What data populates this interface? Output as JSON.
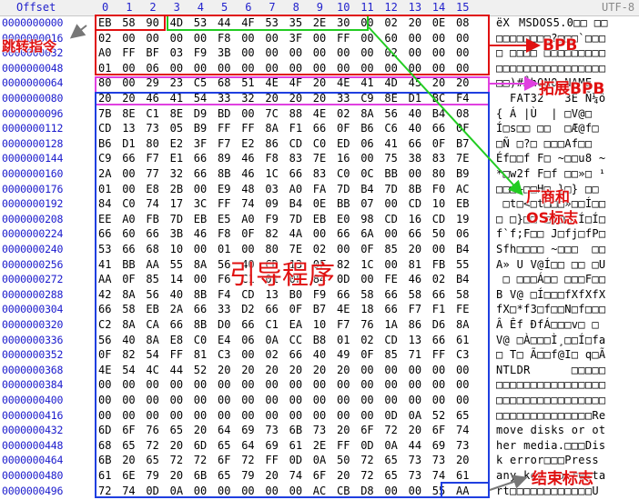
{
  "header": {
    "offset_label": "Offset",
    "columns": [
      "0",
      "1",
      "2",
      "3",
      "4",
      "5",
      "6",
      "7",
      "8",
      "9",
      "10",
      "11",
      "12",
      "13",
      "14",
      "15"
    ],
    "encoding_label": "UTF-8"
  },
  "rows": [
    {
      "offset": "0000000000",
      "hex": [
        "EB",
        "58",
        "90",
        "4D",
        "53",
        "44",
        "4F",
        "53",
        "35",
        "2E",
        "30",
        "00",
        "02",
        "20",
        "0E",
        "08"
      ],
      "text": "ëXMSDOS5.0□□ □□"
    },
    {
      "offset": "0000000016",
      "hex": [
        "02",
        "00",
        "00",
        "00",
        "00",
        "F8",
        "00",
        "00",
        "3F",
        "00",
        "FF",
        "00",
        "60",
        "00",
        "00",
        "00"
      ],
      "text": "□□□□□□□□?□□□`□□□"
    },
    {
      "offset": "0000000032",
      "hex": [
        "A0",
        "FF",
        "BF",
        "03",
        "F9",
        "3B",
        "00",
        "00",
        "00",
        "00",
        "00",
        "00",
        "02",
        "00",
        "00",
        "00"
      ],
      "text": "□ □□□□ □□□□□□□□□"
    },
    {
      "offset": "0000000048",
      "hex": [
        "01",
        "00",
        "06",
        "00",
        "00",
        "00",
        "00",
        "00",
        "00",
        "00",
        "00",
        "00",
        "00",
        "00",
        "00",
        "00"
      ],
      "text": "□□□□□□□□□□□□□□□□"
    },
    {
      "offset": "0000000064",
      "hex": [
        "80",
        "00",
        "29",
        "23",
        "C5",
        "68",
        "51",
        "4E",
        "4F",
        "20",
        "4E",
        "41",
        "4D",
        "45",
        "20",
        "20"
      ],
      "text": "□□)#ÅhQNO NAME  "
    },
    {
      "offset": "0000000080",
      "hex": [
        "20",
        "20",
        "46",
        "41",
        "54",
        "33",
        "32",
        "20",
        "20",
        "20",
        "33",
        "C9",
        "8E",
        "D1",
        "BC",
        "F4"
      ],
      "text": "  FAT32   3É Ñ¼ô"
    },
    {
      "offset": "0000000096",
      "hex": [
        "7B",
        "8E",
        "C1",
        "8E",
        "D9",
        "BD",
        "00",
        "7C",
        "88",
        "4E",
        "02",
        "8A",
        "56",
        "40",
        "B4",
        "08"
      ],
      "text": "{ Á |Ù  | □V@□"
    },
    {
      "offset": "0000000112",
      "hex": [
        "CD",
        "13",
        "73",
        "05",
        "B9",
        "FF",
        "FF",
        "8A",
        "F1",
        "66",
        "0F",
        "B6",
        "C6",
        "40",
        "66",
        "0F"
      ],
      "text": "Í□s□□ □□  □Æ@f□"
    },
    {
      "offset": "0000000128",
      "hex": [
        "B6",
        "D1",
        "80",
        "E2",
        "3F",
        "F7",
        "E2",
        "86",
        "CD",
        "C0",
        "ED",
        "06",
        "41",
        "66",
        "0F",
        "B7"
      ],
      "text": "□Ñ □?□ □□□Af□□"
    },
    {
      "offset": "0000000144",
      "hex": [
        "C9",
        "66",
        "F7",
        "E1",
        "66",
        "89",
        "46",
        "F8",
        "83",
        "7E",
        "16",
        "00",
        "75",
        "38",
        "83",
        "7E"
      ],
      "text": "Éf□□f F□ ~□□u8 ~"
    },
    {
      "offset": "0000000160",
      "hex": [
        "2A",
        "00",
        "77",
        "32",
        "66",
        "8B",
        "46",
        "1C",
        "66",
        "83",
        "C0",
        "0C",
        "BB",
        "00",
        "80",
        "B9"
      ],
      "text": "*□w2f F□f □□»□ ¹"
    },
    {
      "offset": "0000000176",
      "hex": [
        "01",
        "00",
        "E8",
        "2B",
        "00",
        "E9",
        "48",
        "03",
        "A0",
        "FA",
        "7D",
        "B4",
        "7D",
        "8B",
        "F0",
        "AC"
      ],
      "text": "□□□+□□H□ }□} □□"
    },
    {
      "offset": "0000000192",
      "hex": [
        "84",
        "C0",
        "74",
        "17",
        "3C",
        "FF",
        "74",
        "09",
        "B4",
        "0E",
        "BB",
        "07",
        "00",
        "CD",
        "10",
        "EB"
      ],
      "text": " □t□<□t□□□»□□Í□□"
    },
    {
      "offset": "0000000208",
      "hex": [
        "EE",
        "A0",
        "FB",
        "7D",
        "EB",
        "E5",
        "A0",
        "F9",
        "7D",
        "EB",
        "E0",
        "98",
        "CD",
        "16",
        "CD",
        "19"
      ],
      "text": "□ □}□□ □}□□ Í□Í□"
    },
    {
      "offset": "0000000224",
      "hex": [
        "66",
        "60",
        "66",
        "3B",
        "46",
        "F8",
        "0F",
        "82",
        "4A",
        "00",
        "66",
        "6A",
        "00",
        "66",
        "50",
        "06"
      ],
      "text": "f`f;F□□ J□fj□fP□"
    },
    {
      "offset": "0000000240",
      "hex": [
        "53",
        "66",
        "68",
        "10",
        "00",
        "01",
        "00",
        "80",
        "7E",
        "02",
        "00",
        "0F",
        "85",
        "20",
        "00",
        "B4"
      ],
      "text": "Sfh□□□□ ~□□□  □□"
    },
    {
      "offset": "0000000256",
      "hex": [
        "41",
        "BB",
        "AA",
        "55",
        "8A",
        "56",
        "40",
        "CD",
        "13",
        "0F",
        "82",
        "1C",
        "00",
        "81",
        "FB",
        "55"
      ],
      "text": "A» U V@Í□□ □□ □U"
    },
    {
      "offset": "0000000272",
      "hex": [
        "AA",
        "0F",
        "85",
        "14",
        "00",
        "F6",
        "C1",
        "01",
        "0F",
        "84",
        "0D",
        "00",
        "FE",
        "46",
        "02",
        "B4"
      ],
      "text": " □ □□□Á□□ □□□F□□"
    },
    {
      "offset": "0000000288",
      "hex": [
        "42",
        "8A",
        "56",
        "40",
        "8B",
        "F4",
        "CD",
        "13",
        "B0",
        "F9",
        "66",
        "58",
        "66",
        "58",
        "66",
        "58"
      ],
      "text": "B V@ □Í□□□fXfXfX"
    },
    {
      "offset": "0000000304",
      "hex": [
        "66",
        "58",
        "EB",
        "2A",
        "66",
        "33",
        "D2",
        "66",
        "0F",
        "B7",
        "4E",
        "18",
        "66",
        "F7",
        "F1",
        "FE"
      ],
      "text": "fX□*f3□f□□N□f□□□"
    },
    {
      "offset": "0000000320",
      "hex": [
        "C2",
        "8A",
        "CA",
        "66",
        "8B",
        "D0",
        "66",
        "C1",
        "EA",
        "10",
        "F7",
        "76",
        "1A",
        "86",
        "D6",
        "8A"
      ],
      "text": "Â Êf ÐfÁ□□□v□ □ "
    },
    {
      "offset": "0000000336",
      "hex": [
        "56",
        "40",
        "8A",
        "E8",
        "C0",
        "E4",
        "06",
        "0A",
        "CC",
        "B8",
        "01",
        "02",
        "CD",
        "13",
        "66",
        "61"
      ],
      "text": "V@ □À□□□Ì¸□□Í□fa"
    },
    {
      "offset": "0000000352",
      "hex": [
        "0F",
        "82",
        "54",
        "FF",
        "81",
        "C3",
        "00",
        "02",
        "66",
        "40",
        "49",
        "0F",
        "85",
        "71",
        "FF",
        "C3"
      ],
      "text": "□ T□ Ã□□f@I□ q□Ã"
    },
    {
      "offset": "0000000368",
      "hex": [
        "4E",
        "54",
        "4C",
        "44",
        "52",
        "20",
        "20",
        "20",
        "20",
        "20",
        "20",
        "00",
        "00",
        "00",
        "00",
        "00"
      ],
      "text": "NTLDR      □□□□□"
    },
    {
      "offset": "0000000384",
      "hex": [
        "00",
        "00",
        "00",
        "00",
        "00",
        "00",
        "00",
        "00",
        "00",
        "00",
        "00",
        "00",
        "00",
        "00",
        "00",
        "00"
      ],
      "text": "□□□□□□□□□□□□□□□□"
    },
    {
      "offset": "0000000400",
      "hex": [
        "00",
        "00",
        "00",
        "00",
        "00",
        "00",
        "00",
        "00",
        "00",
        "00",
        "00",
        "00",
        "00",
        "00",
        "00",
        "00"
      ],
      "text": "□□□□□□□□□□□□□□□□"
    },
    {
      "offset": "0000000416",
      "hex": [
        "00",
        "00",
        "00",
        "00",
        "00",
        "00",
        "00",
        "00",
        "00",
        "00",
        "00",
        "00",
        "0D",
        "0A",
        "52",
        "65"
      ],
      "text": "□□□□□□□□□□□□□□Re"
    },
    {
      "offset": "0000000432",
      "hex": [
        "6D",
        "6F",
        "76",
        "65",
        "20",
        "64",
        "69",
        "73",
        "6B",
        "73",
        "20",
        "6F",
        "72",
        "20",
        "6F",
        "74"
      ],
      "text": "move disks or ot"
    },
    {
      "offset": "0000000448",
      "hex": [
        "68",
        "65",
        "72",
        "20",
        "6D",
        "65",
        "64",
        "69",
        "61",
        "2E",
        "FF",
        "0D",
        "0A",
        "44",
        "69",
        "73"
      ],
      "text": "her media.□□□Dis"
    },
    {
      "offset": "0000000464",
      "hex": [
        "6B",
        "20",
        "65",
        "72",
        "72",
        "6F",
        "72",
        "FF",
        "0D",
        "0A",
        "50",
        "72",
        "65",
        "73",
        "73",
        "20"
      ],
      "text": "k error□□□Press "
    },
    {
      "offset": "0000000480",
      "hex": [
        "61",
        "6E",
        "79",
        "20",
        "6B",
        "65",
        "79",
        "20",
        "74",
        "6F",
        "20",
        "72",
        "65",
        "73",
        "74",
        "61"
      ],
      "text": "any key to resta"
    },
    {
      "offset": "0000000496",
      "hex": [
        "72",
        "74",
        "0D",
        "0A",
        "00",
        "00",
        "00",
        "00",
        "00",
        "AC",
        "CB",
        "D8",
        "00",
        "00",
        "55",
        "AA"
      ],
      "text": "rt□□□□□□□□□□□□U "
    }
  ],
  "annotations": {
    "jump": "跳转指令",
    "bpb": "BPB",
    "ext_bpb": "拓展BPB",
    "vendor_os": "厂商和\nOS标志",
    "boot_code": "引导程序",
    "end_marker": "结束标志"
  },
  "colors": {
    "offset_text": "#1a1acc",
    "header_text": "#2222cc",
    "red": "#e01010",
    "green": "#22cc22",
    "magenta": "#e040e0",
    "blue": "#1f3fe0"
  }
}
